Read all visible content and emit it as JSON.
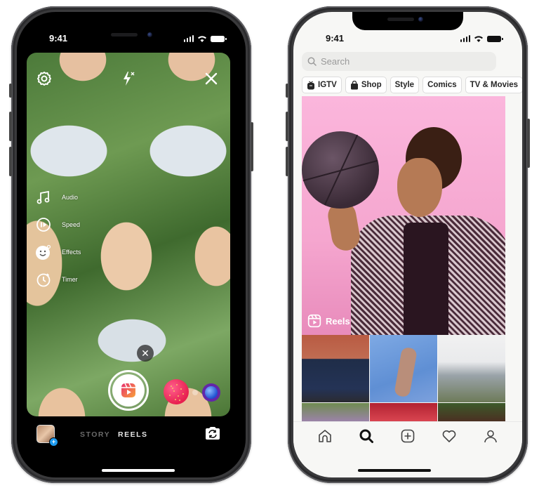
{
  "left_phone": {
    "status_bar": {
      "time": "9:41"
    },
    "camera_top": {
      "settings_icon": "gear-icon",
      "flash_icon": "flash-off-icon",
      "close_icon": "close-icon"
    },
    "tools": [
      {
        "label": "Audio",
        "icon": "music-note-icon"
      },
      {
        "label": "Speed",
        "icon": "speed-icon"
      },
      {
        "label": "Effects",
        "icon": "smiley-icon"
      },
      {
        "label": "Timer",
        "icon": "timer-icon"
      }
    ],
    "dismiss_glyph": "✕",
    "capture_icon": "reels-icon",
    "modes": {
      "story": "STORY",
      "reels": "REELS",
      "active": "REELS"
    },
    "gallery_plus": "+",
    "colors": {
      "capture_gradient_start": "#f14a7a",
      "capture_gradient_end": "#f8a23a",
      "add_badge": "#1d9bf0"
    }
  },
  "right_phone": {
    "status_bar": {
      "time": "9:41"
    },
    "search": {
      "placeholder": "Search",
      "value": ""
    },
    "chips": [
      {
        "label": "IGTV",
        "icon": "igtv-icon"
      },
      {
        "label": "Shop",
        "icon": "shopping-bag-icon"
      },
      {
        "label": "Style",
        "icon": ""
      },
      {
        "label": "Comics",
        "icon": ""
      },
      {
        "label": "TV & Movies",
        "icon": ""
      }
    ],
    "featured": {
      "label": "Reels",
      "icon": "reels-icon",
      "background": "#f9afd6"
    },
    "grid_tiles": 6,
    "tabbar": [
      {
        "name": "home",
        "icon": "home-icon",
        "active": false
      },
      {
        "name": "search",
        "icon": "search-icon",
        "active": true
      },
      {
        "name": "new-post",
        "icon": "add-post-icon",
        "active": false
      },
      {
        "name": "activity",
        "icon": "heart-icon",
        "active": false
      },
      {
        "name": "profile",
        "icon": "profile-icon",
        "active": false
      }
    ]
  }
}
